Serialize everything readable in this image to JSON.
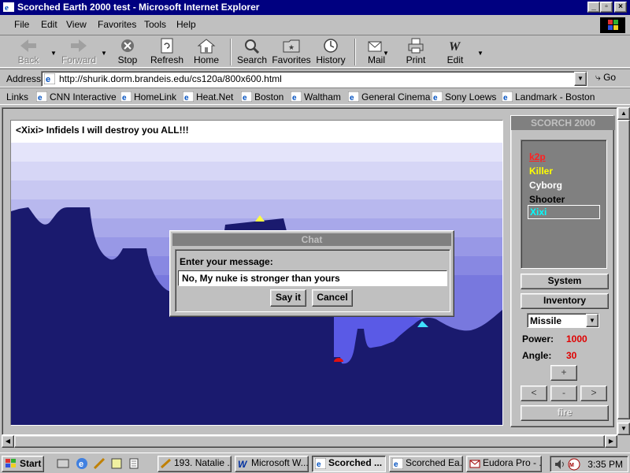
{
  "window": {
    "title": "Scorched Earth 2000 test - Microsoft Internet Explorer"
  },
  "menu": [
    "File",
    "Edit",
    "View",
    "Favorites",
    "Tools",
    "Help"
  ],
  "toolbar": {
    "back": "Back",
    "forward": "Forward",
    "stop": "Stop",
    "refresh": "Refresh",
    "home": "Home",
    "search": "Search",
    "favorites": "Favorites",
    "history": "History",
    "mail": "Mail",
    "print": "Print",
    "edit": "Edit"
  },
  "address": {
    "label": "Address",
    "url": "http://shurik.dorm.brandeis.edu/cs120a/800x600.html",
    "go": "Go"
  },
  "links": {
    "label": "Links",
    "items": [
      "CNN Interactive",
      "HomeLink",
      "Heat.Net",
      "Boston",
      "Waltham",
      "General Cinema",
      "Sony Loews",
      "Landmark - Boston"
    ]
  },
  "game": {
    "chat_message": "<Xixi> Infidels I will destroy you ALL!!!",
    "colors": {
      "sky_top": "#ffffff",
      "sky_bottom": "#7070e0",
      "terrain": "#1a1a6e",
      "crater": "#5050e0"
    }
  },
  "dialog": {
    "title": "Chat",
    "prompt": "Enter your message:",
    "input_value": "No, My nuke is stronger than yours",
    "say_button": "Say it",
    "cancel_button": "Cancel"
  },
  "panel": {
    "title": "SCORCH 2000",
    "players": [
      {
        "name": "k2p",
        "color": "#ff2020"
      },
      {
        "name": "Killer",
        "color": "#ffff00"
      },
      {
        "name": "Cyborg",
        "color": "#ffffff"
      },
      {
        "name": "Shooter",
        "color": "#000000"
      },
      {
        "name": "Xixi",
        "color": "#00ffff"
      }
    ],
    "system_button": "System",
    "inventory_button": "Inventory",
    "weapon": "Missile",
    "power_label": "Power:",
    "power_value": "1000",
    "angle_label": "Angle:",
    "angle_value": "30",
    "up_button": "+",
    "left_button": "<",
    "down_button": "-",
    "right_button": ">",
    "fire_button": "fire"
  },
  "taskbar": {
    "start": "Start",
    "tasks": [
      "193. Natalie ...",
      "Microsoft W...",
      "Scorched ...",
      "Scorched Ea...",
      "Eudora Pro - ..."
    ],
    "clock": "3:35 PM"
  }
}
